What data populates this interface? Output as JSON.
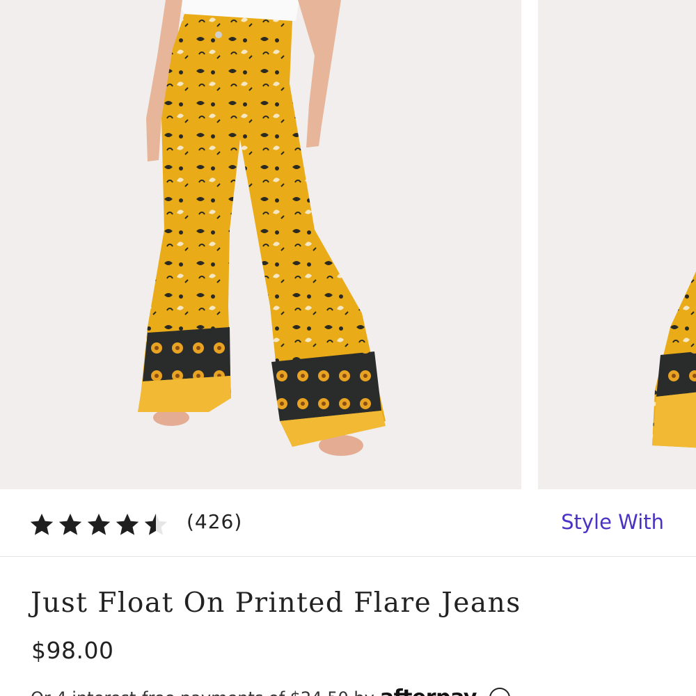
{
  "product": {
    "title": "Just Float On Printed Flare Jeans",
    "price": "$98.00",
    "rating": 4.5,
    "rating_max": 5,
    "review_count": "(426)",
    "style_with_label": "Style With"
  },
  "payment": {
    "installment_text": "Or 4 interest-free payments of $24.50 by",
    "provider_logo": "afterpay",
    "info_icon": "info-icon"
  },
  "colors": {
    "accent": "#4a33c4",
    "text": "#222222",
    "jeans_yellow": "#e9ac18",
    "image_background": "#f1eeed"
  },
  "images": [
    {
      "alt": "yellow printed flare jeans product photo"
    },
    {
      "alt": "yellow printed flare jeans alternate view"
    }
  ]
}
